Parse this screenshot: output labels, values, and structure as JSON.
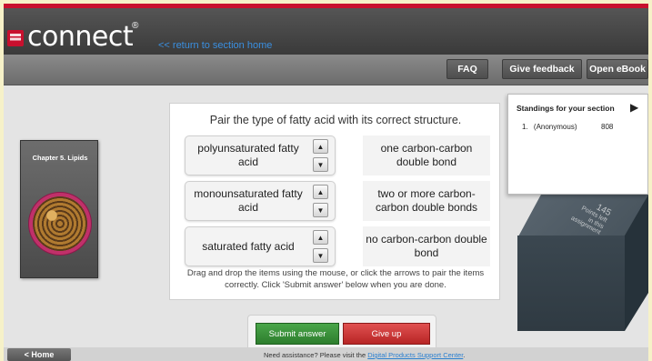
{
  "header": {
    "logo_text": "connect",
    "logo_mark": "®",
    "return_link": "<< return to section home"
  },
  "toolbar": {
    "faq": "FAQ",
    "feedback": "Give feedback",
    "open_ebook": "Open eBook"
  },
  "chapter": {
    "label": "Chapter 5. Lipids",
    "image_icon": "lipid-molecule-icon"
  },
  "activity": {
    "prompt": "Pair the type of fatty acid with its correct structure.",
    "items": [
      {
        "label": "polyunsaturated fatty acid"
      },
      {
        "label": "monounsaturated fatty acid"
      },
      {
        "label": "saturated fatty acid"
      }
    ],
    "structures": [
      {
        "label": "one carbon-carbon double bond"
      },
      {
        "label": "two or more carbon-carbon double bonds"
      },
      {
        "label": "no carbon-carbon double bond"
      }
    ],
    "instructions": "Drag and drop the items using the mouse, or click the arrows to pair the items correctly. Click 'Submit answer' below when you are done."
  },
  "standings": {
    "title": "Standings for your section",
    "rows": [
      {
        "rank": "1.",
        "name": "(Anonymous)",
        "score": "808"
      }
    ]
  },
  "points_box": {
    "value": "145",
    "caption_1": "Points left",
    "caption_2": "in this",
    "caption_3": "assignment"
  },
  "actions": {
    "submit": "Submit answer",
    "give_up": "Give up"
  },
  "footer": {
    "home": "< Home",
    "assist_text": "Need assistance? Please visit the ",
    "assist_link": "Digital Products Support Center",
    "assist_end": "."
  },
  "colors": {
    "brand_red": "#c8102e",
    "link_blue": "#3a8fe0",
    "submit_green": "#2d7d2d",
    "give_up_red": "#b82626"
  }
}
